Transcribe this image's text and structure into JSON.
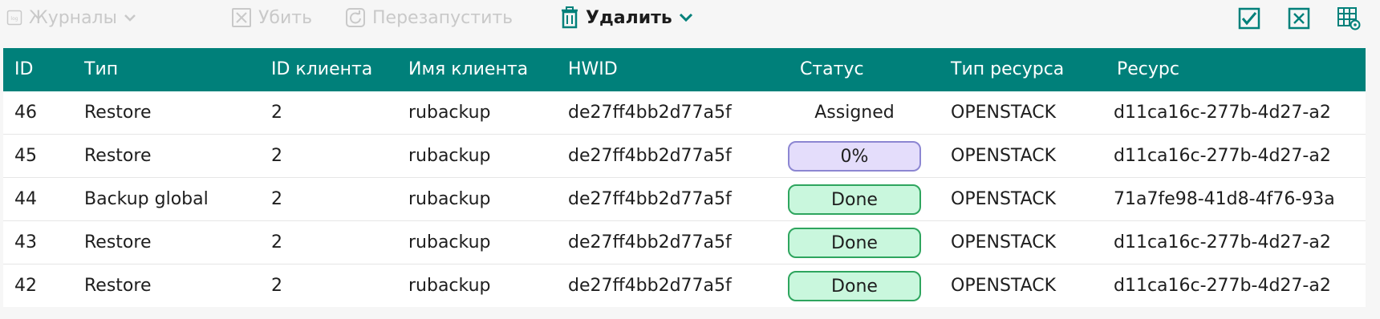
{
  "toolbar": {
    "logs_label": "Журналы",
    "kill_label": "Убить",
    "restart_label": "Перезапустить",
    "delete_label": "Удалить",
    "logs_icon": "log-file-icon",
    "kill_icon": "kill-x-icon",
    "restart_icon": "restart-icon",
    "delete_icon": "trash-icon",
    "right_icons": [
      "select-all-checkbox-icon",
      "deselect-x-icon",
      "table-settings-icon"
    ]
  },
  "colors": {
    "header_bg": "#00807a",
    "accent": "#00807a",
    "done_bg": "#c9f7dd",
    "done_border": "#2ea55e",
    "progress_bg": "#e4ddfb",
    "progress_border": "#8c86d2"
  },
  "table": {
    "columns": [
      "ID",
      "Тип",
      "ID клиента",
      "Имя клиента",
      "HWID",
      "Статус",
      "Тип ресурса",
      "Ресурс"
    ],
    "rows": [
      {
        "id": "46",
        "type": "Restore",
        "client_id": "2",
        "client_name": "rubackup",
        "hwid": "de27ff4bb2d77a5f",
        "status": "Assigned",
        "status_style": "plain",
        "resource_type": "OPENSTACK",
        "resource": "d11ca16c-277b-4d27-a2"
      },
      {
        "id": "45",
        "type": "Restore",
        "client_id": "2",
        "client_name": "rubackup",
        "hwid": "de27ff4bb2d77a5f",
        "status": "0%",
        "status_style": "progress",
        "resource_type": "OPENSTACK",
        "resource": "d11ca16c-277b-4d27-a2"
      },
      {
        "id": "44",
        "type": "Backup global",
        "client_id": "2",
        "client_name": "rubackup",
        "hwid": "de27ff4bb2d77a5f",
        "status": "Done",
        "status_style": "done",
        "resource_type": "OPENSTACK",
        "resource": "71a7fe98-41d8-4f76-93a"
      },
      {
        "id": "43",
        "type": "Restore",
        "client_id": "2",
        "client_name": "rubackup",
        "hwid": "de27ff4bb2d77a5f",
        "status": "Done",
        "status_style": "done",
        "resource_type": "OPENSTACK",
        "resource": "d11ca16c-277b-4d27-a2"
      },
      {
        "id": "42",
        "type": "Restore",
        "client_id": "2",
        "client_name": "rubackup",
        "hwid": "de27ff4bb2d77a5f",
        "status": "Done",
        "status_style": "done",
        "resource_type": "OPENSTACK",
        "resource": "d11ca16c-277b-4d27-a2"
      }
    ]
  }
}
